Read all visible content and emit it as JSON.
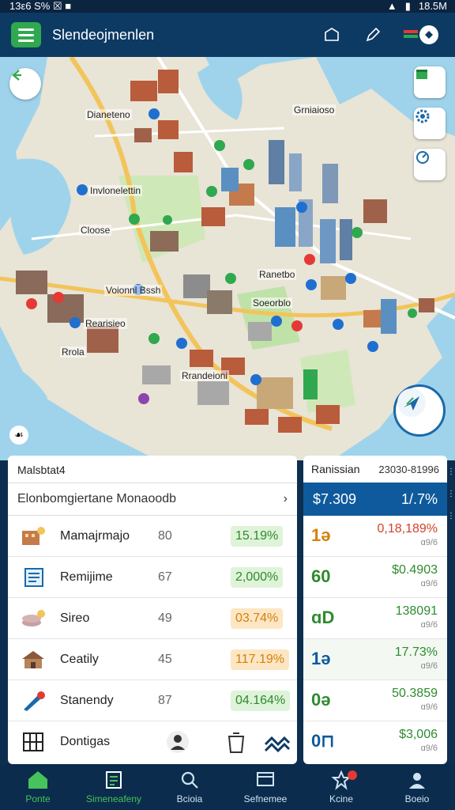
{
  "status_bar": {
    "left": "13ε6 S% ☒ ■",
    "right": "18.5M"
  },
  "app_bar": {
    "title": "Slendeojmenlen"
  },
  "map": {
    "labels": [
      "Dianeteno",
      "Invlonelettin",
      "Cloose",
      "Voionnl Bssh",
      "Rearisieo",
      "Rrola",
      "Ranetbo",
      "Soeorblo",
      "Rrandeioni",
      "Grniaioso"
    ]
  },
  "left_panel": {
    "title": "Malsbtat4",
    "selector": "Elonbomgiertane Monaoodb",
    "rows": [
      {
        "label": "Mamajrmajo",
        "num": "80",
        "pct": "15.19%",
        "tone": "green"
      },
      {
        "label": "Remijime",
        "num": "67",
        "pct": "2,000%",
        "tone": "green"
      },
      {
        "label": "Sireo",
        "num": "49",
        "pct": "03.74%",
        "tone": "orange"
      },
      {
        "label": "Ceatily",
        "num": "45",
        "pct": "117.19%",
        "tone": "orange"
      },
      {
        "label": "Stanendy",
        "num": "87",
        "pct": "04.164%",
        "tone": "green"
      }
    ],
    "footer_label": "Dontigas"
  },
  "right_panel": {
    "title": "Ranissian",
    "number": "23030-81996",
    "banner_left": "$7.309",
    "banner_right": "1/.7%",
    "rows": [
      {
        "icon": "1ə",
        "value": "0,18,189%",
        "sub": "ɑ9/6",
        "color": "#d4412a"
      },
      {
        "icon": "60",
        "value": "$0.4903",
        "sub": "ɑ9/6",
        "color": "#2e8b2e"
      },
      {
        "icon": "ɑD",
        "value": "138091",
        "sub": "ɑ9/6",
        "color": "#2e8b2e"
      },
      {
        "icon": "1ə",
        "value": "17.73%",
        "sub": "ɑ9/6",
        "color": "#0f5a9c"
      },
      {
        "icon": "0ə",
        "value": "50.3859",
        "sub": "ɑ9/6",
        "color": "#2e8b2e"
      },
      {
        "icon": "0⊓",
        "value": "$3,006",
        "sub": "ɑ9/6",
        "color": "#2e8b2e"
      }
    ]
  },
  "bottom_nav": [
    {
      "label": "Ponte",
      "icon": "home-icon"
    },
    {
      "label": "Simeneafeny",
      "icon": "list-icon"
    },
    {
      "label": "Bcioia",
      "icon": "search-icon"
    },
    {
      "label": "Sefnemee",
      "icon": "screen-icon"
    },
    {
      "label": "Kcine",
      "icon": "star-icon"
    },
    {
      "label": "Boeio",
      "icon": "user-icon"
    }
  ],
  "colors": {
    "accent_green": "#2fa84f",
    "brand_blue": "#0d3a63"
  }
}
